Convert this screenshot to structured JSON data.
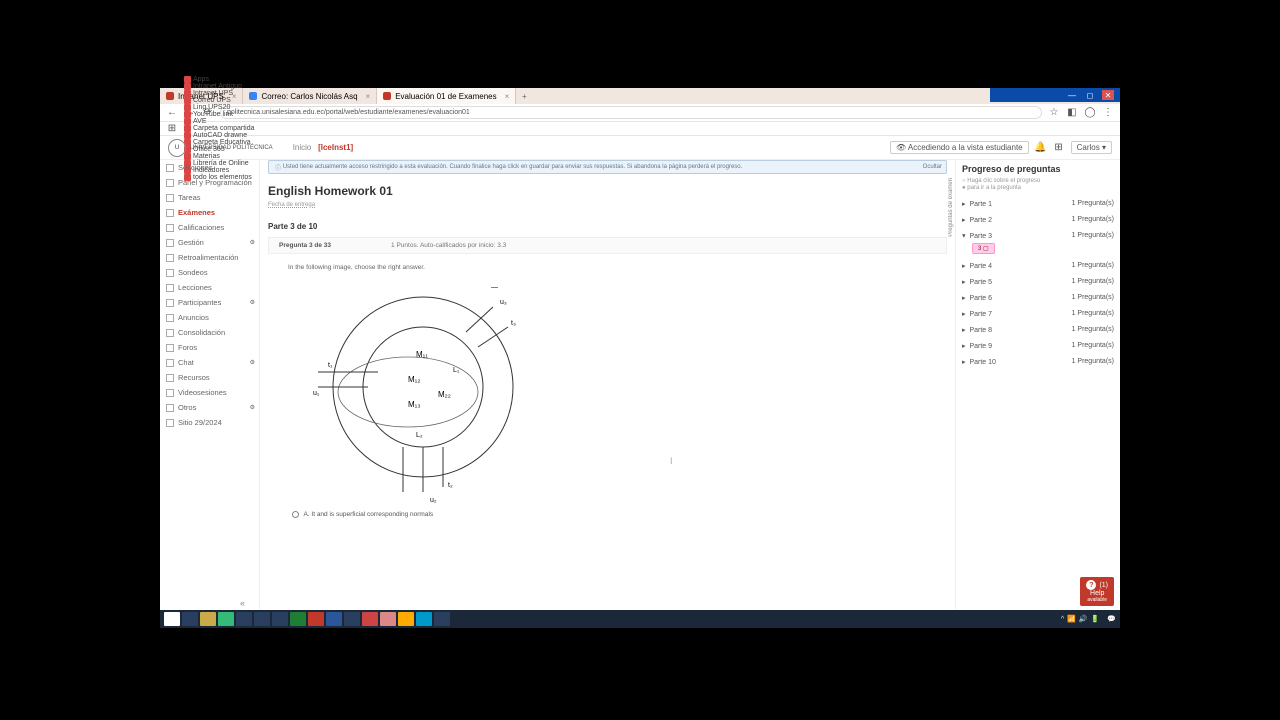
{
  "browser": {
    "tabs": [
      {
        "label": "Intranet UPS"
      },
      {
        "label": "Correo: Carlos Nicolás Asq"
      },
      {
        "label": "Evaluación 01 de Examenes"
      }
    ],
    "url": "politecnica.unisalesiana.edu.ec/portal/web/estudiante/examenes/evaluacion01",
    "bookmarks": [
      "Apps",
      "Intranet Antiguo",
      "Intranet UPS",
      "Correo UPS",
      "Ling UPS20",
      "YouTube link",
      "AVE",
      "Carpeta compartida",
      "AutoCAD drawne",
      "Carpeta Educativa",
      "Office 365",
      "Materias",
      "Librería de Online",
      "Indicadores",
      "todo los elementos"
    ]
  },
  "app": {
    "university": "UNIVERSIDAD POLITÉCNICA",
    "crumb_prefix": "Inicio",
    "crumb_current": "[IceInst1]",
    "student_view": "Accediendo a la vista estudiante",
    "user": "Carlos"
  },
  "sidebar": {
    "items": [
      "Secciones",
      "Panel y Programación",
      "Tareas",
      "Exámenes",
      "Calificaciones",
      "Gestión",
      "Retroalimentación",
      "Sondeos",
      "Lecciones",
      "Participantes",
      "Anuncios",
      "Consolidación",
      "Foros",
      "Chat",
      "Recursos",
      "Videosesiones",
      "Otros",
      "Sitio 29/2024"
    ],
    "active_index": 3
  },
  "banner": {
    "text": "Usted tiene actualmente acceso restringido a esta evaluación. Cuando finalice haga click en guardar para enviar sus respuestas. Si abandona la página perderá el progreso.",
    "hide": "Ocultar"
  },
  "assignment": {
    "title": "English Homework 01",
    "due": "Fecha de entrega",
    "part_label": "Parte 3 de 10",
    "qbar_left": "Pregunta 3 de 33",
    "qbar_right": "1 Puntos. Auto-calificados por inicio: 3.3",
    "instruction": "In the following image, choose the right answer.",
    "optionA": "A. It and is superficial corresponding normals"
  },
  "progress": {
    "title": "Progreso de preguntas",
    "hint1": "Haga clic sobre el progreso",
    "hint2": "para ir a la pregunta",
    "parts": [
      {
        "label": "Parte 1",
        "count": "1 Pregunta(s)"
      },
      {
        "label": "Parte 2",
        "count": "1 Pregunta(s)"
      },
      {
        "label": "Parte 3",
        "count": "1 Pregunta(s)",
        "open": true,
        "chip": "3 ▢"
      },
      {
        "label": "Parte 4",
        "count": "1 Pregunta(s)"
      },
      {
        "label": "Parte 5",
        "count": "1 Pregunta(s)"
      },
      {
        "label": "Parte 6",
        "count": "1 Pregunta(s)"
      },
      {
        "label": "Parte 7",
        "count": "1 Pregunta(s)"
      },
      {
        "label": "Parte 8",
        "count": "1 Pregunta(s)"
      },
      {
        "label": "Parte 9",
        "count": "1 Pregunta(s)"
      },
      {
        "label": "Parte 10",
        "count": "1 Pregunta(s)"
      }
    ]
  },
  "fab": {
    "badge": "(1)",
    "label": "Help",
    "sub": "available"
  },
  "vertical_label": "Preguntas de examen"
}
